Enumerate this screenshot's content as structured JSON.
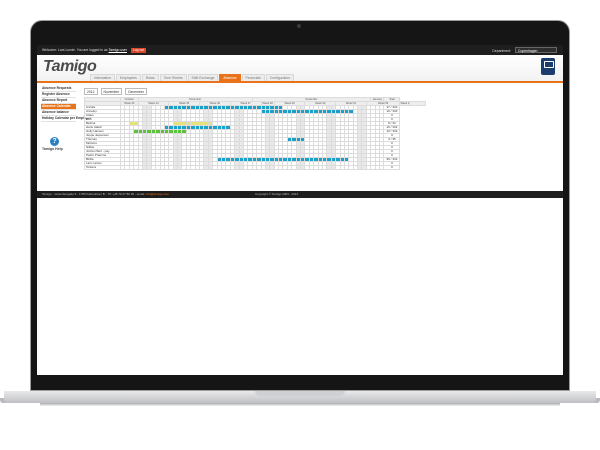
{
  "topbar": {
    "welcome": "Welcome: Lars Lunde. You are logged in as",
    "user_link": "Tamigo user",
    "logout": "Log out",
    "department_label": "Department:",
    "department_value": "Copenhagen"
  },
  "brand": {
    "logo_text": "Tamigo"
  },
  "nav": {
    "tabs": [
      "Information",
      "Employees",
      "Rotas",
      "Time Sheets",
      "Shift Exchange",
      "Absence",
      "Financials",
      "Configuration"
    ],
    "active": "Absence"
  },
  "sidebar": {
    "items": [
      "Absence Requests",
      "Register Absence",
      "Absence Report",
      "Absence Calendar",
      "Absence balance",
      "Holiday Calendar per Employee"
    ],
    "active": "Absence Calendar"
  },
  "help": {
    "label": "Tamigo Help"
  },
  "filters": {
    "year": "2012",
    "from_month": "November",
    "to_month": "December"
  },
  "calendar": {
    "months": [
      "October",
      "November",
      "December",
      "January"
    ],
    "total_label": "Total",
    "week_labels": [
      "Week 43",
      "Week 44",
      "Week 45",
      "Week 46",
      "Week 47",
      "Week 48",
      "Week 49",
      "Week 50",
      "Week 51",
      "Week 52",
      "Week 1"
    ],
    "employees": [
      {
        "name": "Annika",
        "total": "47 / 332"
      },
      {
        "name": "Anneley",
        "total": "16 / 332"
      },
      {
        "name": "Claus",
        "total": "0"
      },
      {
        "name": "Dan",
        "total": "0"
      },
      {
        "name": "Bettina",
        "total": "8 / 32"
      },
      {
        "name": "Hans Jakob",
        "total": "16 / 332"
      },
      {
        "name": "Holly Hansen",
        "total": "10 / 332"
      },
      {
        "name": "Jeppe Jespersen",
        "total": "0"
      },
      {
        "name": "Thomas",
        "total": "3 / 35"
      },
      {
        "name": "Mortens",
        "total": "0"
      },
      {
        "name": "Niklas",
        "total": "0"
      },
      {
        "name": "Jochen Bert - pay",
        "total": "0"
      },
      {
        "name": "Pedro Praeima",
        "total": "0"
      },
      {
        "name": "Birdie",
        "total": "96 / 332"
      },
      {
        "name": "Lars Larsen",
        "total": "0"
      },
      {
        "name": "Torkera",
        "total": "0"
      }
    ]
  },
  "footer": {
    "address": "Tamigo - Vesterbrogade 6 - 1780 København B - Tlf: +45 70 27 80 30 - email:",
    "email": "info@tamigo.com",
    "copyright": "Copyright © Tamigo 2004 - 2013"
  },
  "colors": {
    "accent": "#e8731a",
    "absence_blue": "#1aa0c9",
    "absence_green": "#5cc23c",
    "absence_yellow": "#e6e27a"
  }
}
